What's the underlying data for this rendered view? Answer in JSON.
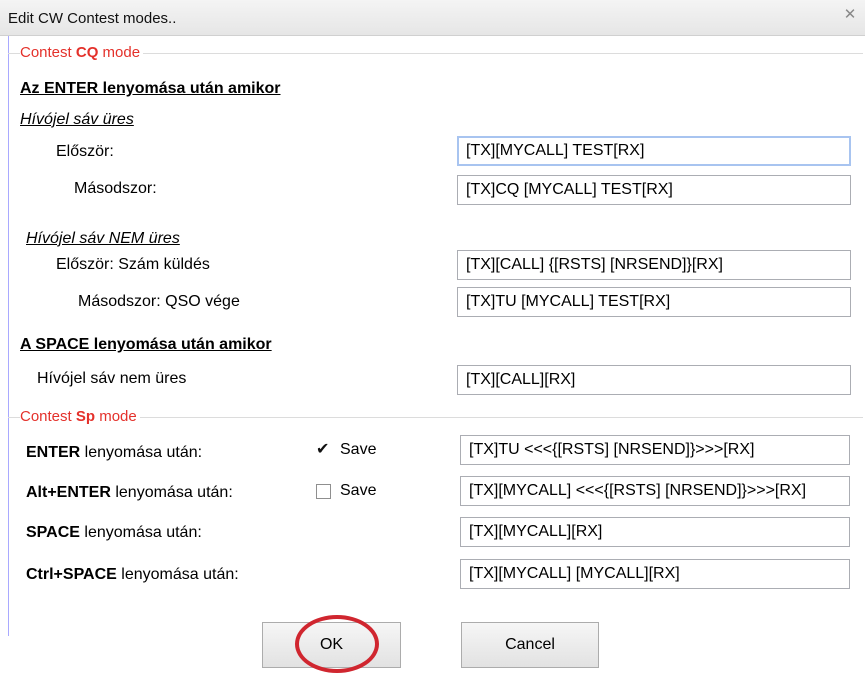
{
  "window": {
    "title": "Edit CW Contest modes..",
    "close_glyph": "✕"
  },
  "cq_group": {
    "label_prefix": "Contest ",
    "label_bold": "CQ",
    "label_suffix": " mode"
  },
  "enter_heading": "Az ENTER lenyomása után amikor",
  "empty_heading": "Hívójel sáv üres",
  "empty_first_label": "Először:",
  "empty_first_value": "[TX][MYCALL] TEST[RX]",
  "empty_second_label": "Másodszor:",
  "empty_second_value": "[TX]CQ [MYCALL] TEST[RX]",
  "notempty_heading": "Hívójel sáv NEM üres",
  "notempty_first_label": "Először: Szám küldés",
  "notempty_first_value": "[TX][CALL] {[RSTS] [NRSEND]}[RX]",
  "notempty_second_label": "Másodszor: QSO vége",
  "notempty_second_value": "[TX]TU [MYCALL] TEST[RX]",
  "space_heading": "A SPACE lenyomása után amikor",
  "space_label": "Hívójel sáv nem üres",
  "space_value": "[TX][CALL][RX]",
  "sp_group": {
    "label_prefix": "Contest ",
    "label_bold": "Sp",
    "label_suffix": " mode"
  },
  "sp_rows": [
    {
      "key": "ENTER",
      "rest": " lenyomása után:",
      "save_label": "Save",
      "checked": true,
      "value": "[TX]TU <<<{[RSTS] [NRSEND]}>>>[RX]"
    },
    {
      "key": "Alt+ENTER",
      "rest": " lenyomása után:",
      "save_label": "Save",
      "checked": false,
      "value": "[TX][MYCALL] <<<{[RSTS] [NRSEND]}>>>[RX]"
    },
    {
      "key": "SPACE",
      "rest": " lenyomása után:",
      "value": "[TX][MYCALL][RX]"
    },
    {
      "key": "Ctrl+SPACE",
      "rest": " lenyomása után:",
      "value": "[TX][MYCALL] [MYCALL][RX]"
    }
  ],
  "buttons": {
    "ok": "OK",
    "cancel": "Cancel"
  },
  "colors": {
    "accent_red": "#e4312b",
    "highlight_circle": "#d0262f",
    "focus_border": "#a8c4f0"
  }
}
